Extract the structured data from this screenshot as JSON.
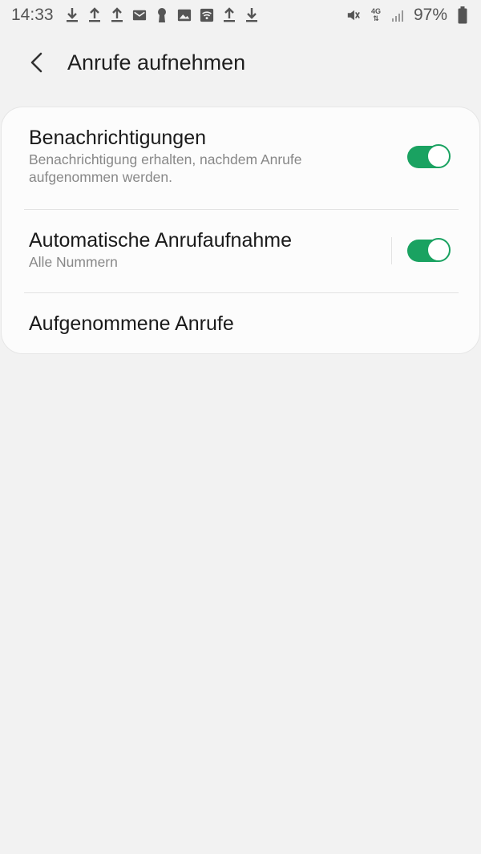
{
  "status_bar": {
    "time": "14:33",
    "battery_percent": "97%",
    "network_label": "4G",
    "notification_icons": [
      "download-icon",
      "upload-icon",
      "upload-icon",
      "mail-icon",
      "lock-icon",
      "image-icon",
      "wifi-icon",
      "upload-icon",
      "download-icon"
    ],
    "right_icons": [
      "mute-icon",
      "network-4g-icon",
      "signal-icon",
      "battery-icon"
    ]
  },
  "header": {
    "title": "Anrufe aufnehmen"
  },
  "settings": {
    "items": [
      {
        "title": "Benachrichtigungen",
        "subtitle": "Benachrichtigung erhalten, nachdem Anrufe aufgenommen werden.",
        "toggle_on": true
      },
      {
        "title": "Automatische Anrufaufnahme",
        "subtitle": "Alle Nummern",
        "toggle_on": true
      },
      {
        "title": "Aufgenommene Anrufe"
      }
    ]
  },
  "colors": {
    "accent": "#1aa261",
    "background": "#f2f2f2",
    "card": "#fcfcfc",
    "subtitle_text": "#888888"
  }
}
